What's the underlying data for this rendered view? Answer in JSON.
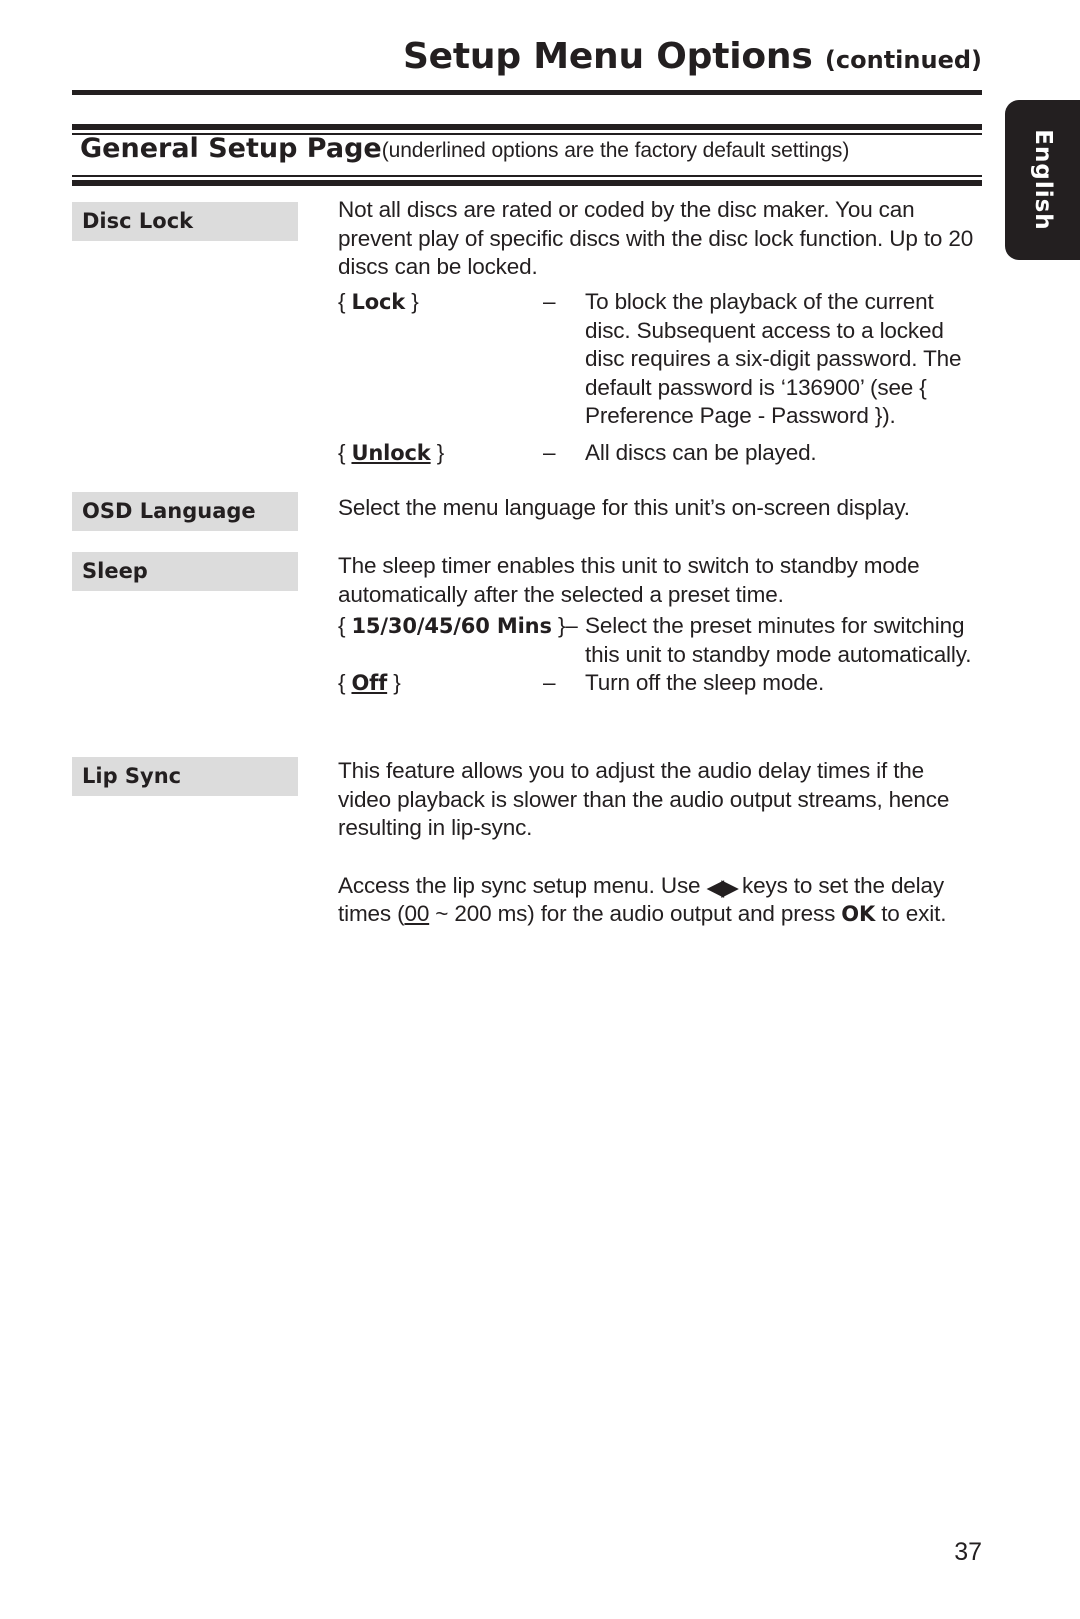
{
  "header": {
    "title": "Setup Menu Options",
    "continued": "(continued)"
  },
  "section": {
    "heading": "General Setup Page",
    "note": "(underlined options are the factory default settings)"
  },
  "side_tab": {
    "label": "English"
  },
  "entries": {
    "disc_lock": {
      "term": "Disc Lock",
      "intro": "Not all discs are rated or coded by the disc maker. You can prevent play of specific discs with the disc lock function. Up to 20 discs can be locked.",
      "options": [
        {
          "name": "{ Lock }",
          "name_open": "{ ",
          "name_value": "Lock",
          "name_close": " }",
          "underlined": false,
          "dash": "–",
          "desc": "To block the playback of the current disc. Subsequent access to a locked disc requires a six-digit password. The default password is ‘136900’ (see { Preference Page - Password })."
        },
        {
          "name": "{ Unlock }",
          "name_open": "{ ",
          "name_value": "Unlock",
          "name_close": " }",
          "underlined": true,
          "dash": "–",
          "desc": "All discs can be played."
        }
      ]
    },
    "osd_language": {
      "term": "OSD Language",
      "intro": "Select the menu language for this unit’s on-screen display."
    },
    "sleep": {
      "term": "Sleep",
      "intro": "The sleep timer enables this unit to switch to standby mode automatically after the selected a preset time.",
      "options": [
        {
          "name": "{ 15/30/45/60 Mins }–",
          "name_open": "{ ",
          "name_value": "15/30/45/60 Mins",
          "name_close": " }–",
          "underlined": false,
          "dash": "",
          "desc": "Select the preset minutes for switching this unit to standby mode automatically."
        },
        {
          "name": "{ Off }",
          "name_open": "{ ",
          "name_value": "Off",
          "name_close": " }",
          "underlined": true,
          "dash": "–",
          "desc": "Turn off the sleep mode."
        }
      ]
    },
    "lip_sync": {
      "term": "Lip Sync",
      "intro": "This feature allows you to adjust the audio delay times if the video playback is slower than the audio output streams, hence resulting in lip-sync.",
      "para2_a": "Access the lip sync setup menu. Use ",
      "para2_arrows": "◀▶",
      "para2_b": " keys to set the delay times (",
      "para2_default": "00",
      "para2_c": " ~ 200 ms) for the audio output and press ",
      "para2_ok": "OK",
      "para2_d": " to exit."
    }
  },
  "footer": {
    "page_number": "37"
  }
}
